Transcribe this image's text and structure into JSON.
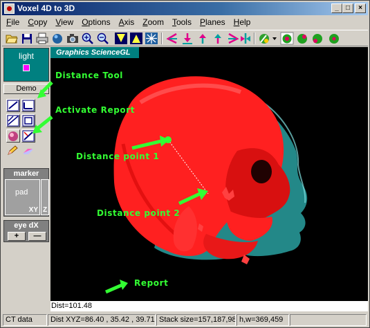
{
  "window": {
    "title": "Voxel 4D to 3D"
  },
  "menu": [
    "File",
    "Copy",
    "View",
    "Options",
    "Axis",
    "Zoom",
    "Tools",
    "Planes",
    "Help"
  ],
  "left_panel": {
    "light_label": "light",
    "demo_label": "Demo",
    "marker_label": "marker",
    "pad_label": "pad",
    "pad_xy": "XY",
    "pad_z": "Z",
    "eye_label": "eye dX",
    "eye_plus": "+",
    "eye_minus": "—"
  },
  "viewport": {
    "graphics_label": "Graphics ScienceGL",
    "annotations": {
      "distance_tool": "Distance Tool",
      "activate_report": "Activate Report",
      "distance_point_1": "Distance point 1",
      "distance_point_2": "Distance point 2",
      "report": "Report"
    }
  },
  "report": {
    "text": "Dist=101.48"
  },
  "status": {
    "cells": [
      "CT data",
      "Dist XYZ=86.40 , 35.42 , 39.71",
      "Stack size=157,187,98",
      "h,w=369,459"
    ]
  },
  "colors": {
    "annotation": "#33ff33",
    "skull": "#ff2020",
    "skin": "#2fb5b5",
    "panel_teal": "#008080"
  }
}
